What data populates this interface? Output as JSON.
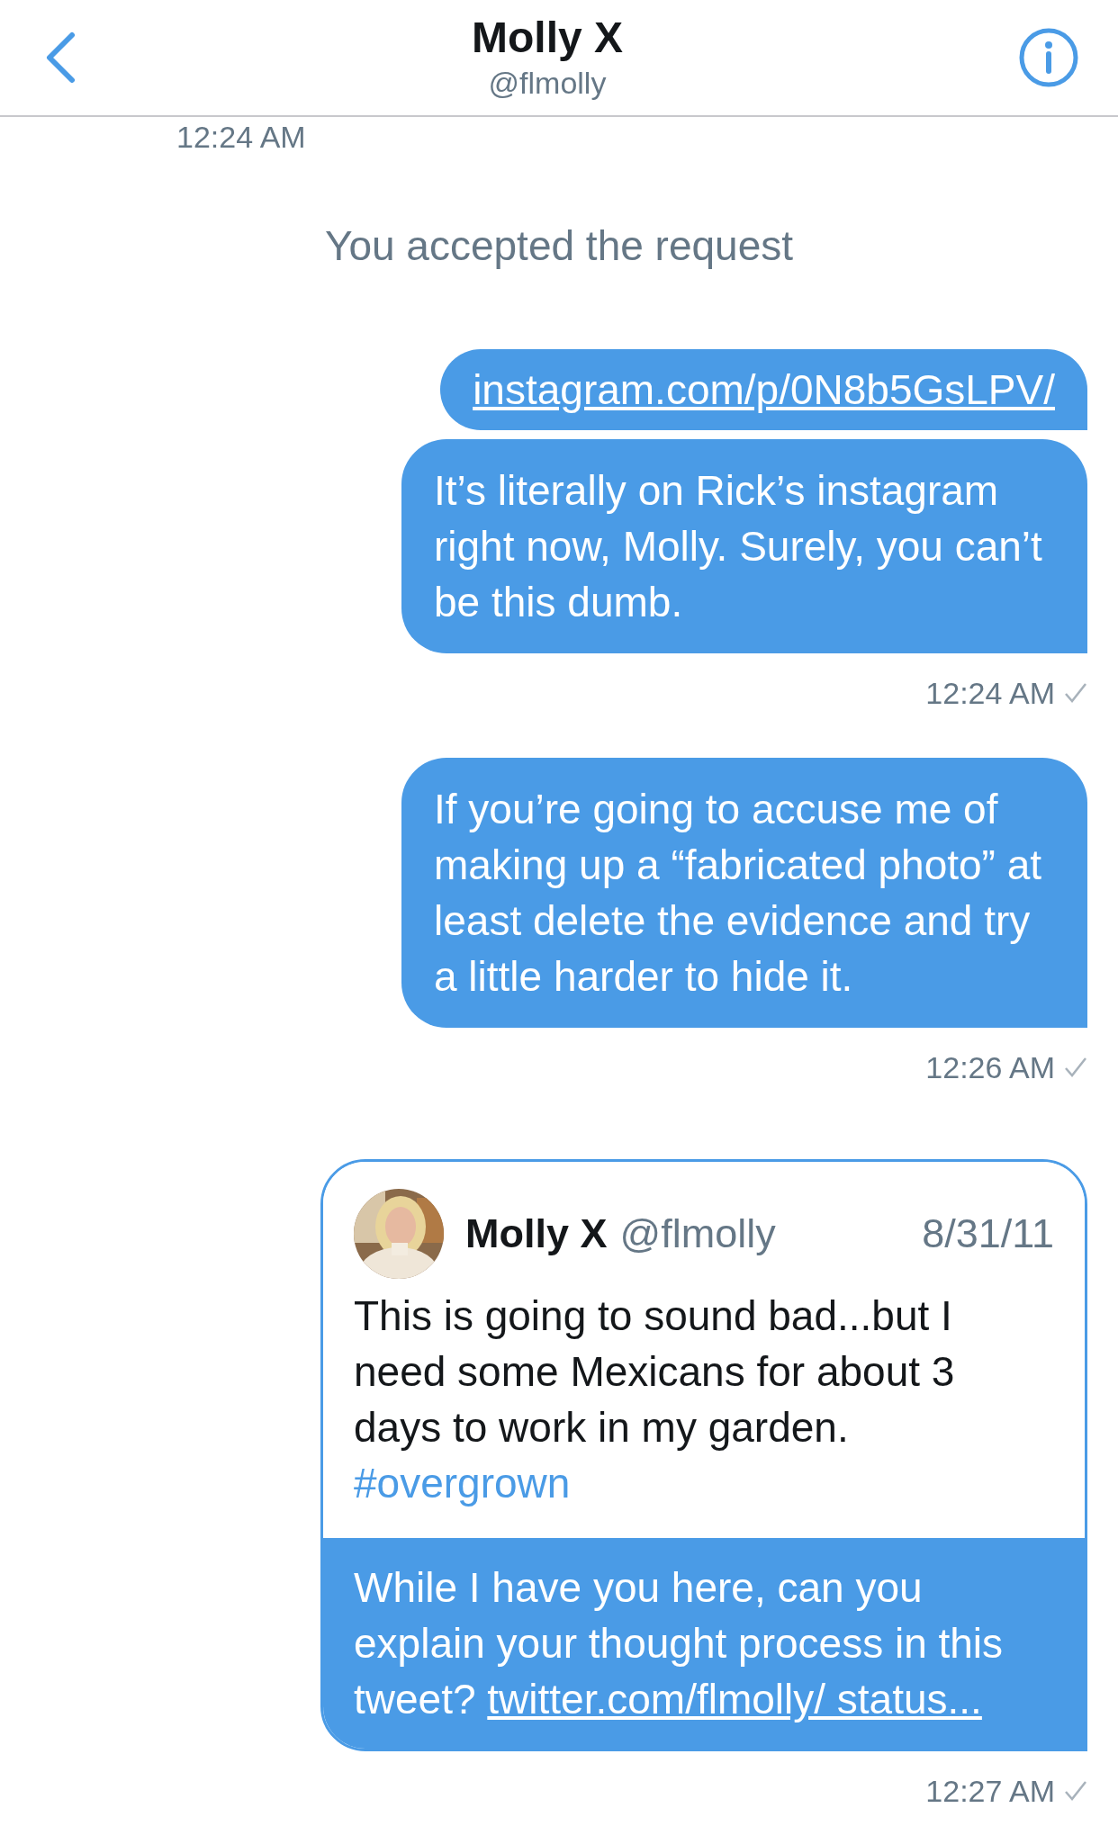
{
  "header": {
    "title": "Molly X",
    "handle": "@flmolly"
  },
  "messages": [
    {
      "kind": "time",
      "text": "12:24 AM",
      "sent": false
    },
    {
      "kind": "system",
      "text": "You accepted the request"
    },
    {
      "kind": "bubble",
      "link": "instagram.com/p/0N8b5GsLPV/"
    },
    {
      "kind": "bubble",
      "text": "It’s literally on Rick’s instagram right now, Molly. Surely, you can’t be this dumb."
    },
    {
      "kind": "time",
      "text": "12:24 AM",
      "sent": true
    },
    {
      "kind": "bubble",
      "text": "If you’re going to accuse me of making up a “fabricated photo” at least delete the evidence and try a little harder to hide it."
    },
    {
      "kind": "time",
      "text": "12:26 AM",
      "sent": true
    },
    {
      "kind": "tweet",
      "tweet": {
        "name": "Molly X",
        "handle": "@flmolly",
        "date": "8/31/11",
        "body": "This is going to sound bad...but I need some Mexicans for about 3 days to work in my garden.",
        "hashtag": "#overgrown"
      },
      "text": "While I have you here, can you explain your thought process in this tweet?",
      "link": "twitter.com/flmolly/ status..."
    },
    {
      "kind": "time",
      "text": "12:27 AM",
      "sent": true
    }
  ]
}
